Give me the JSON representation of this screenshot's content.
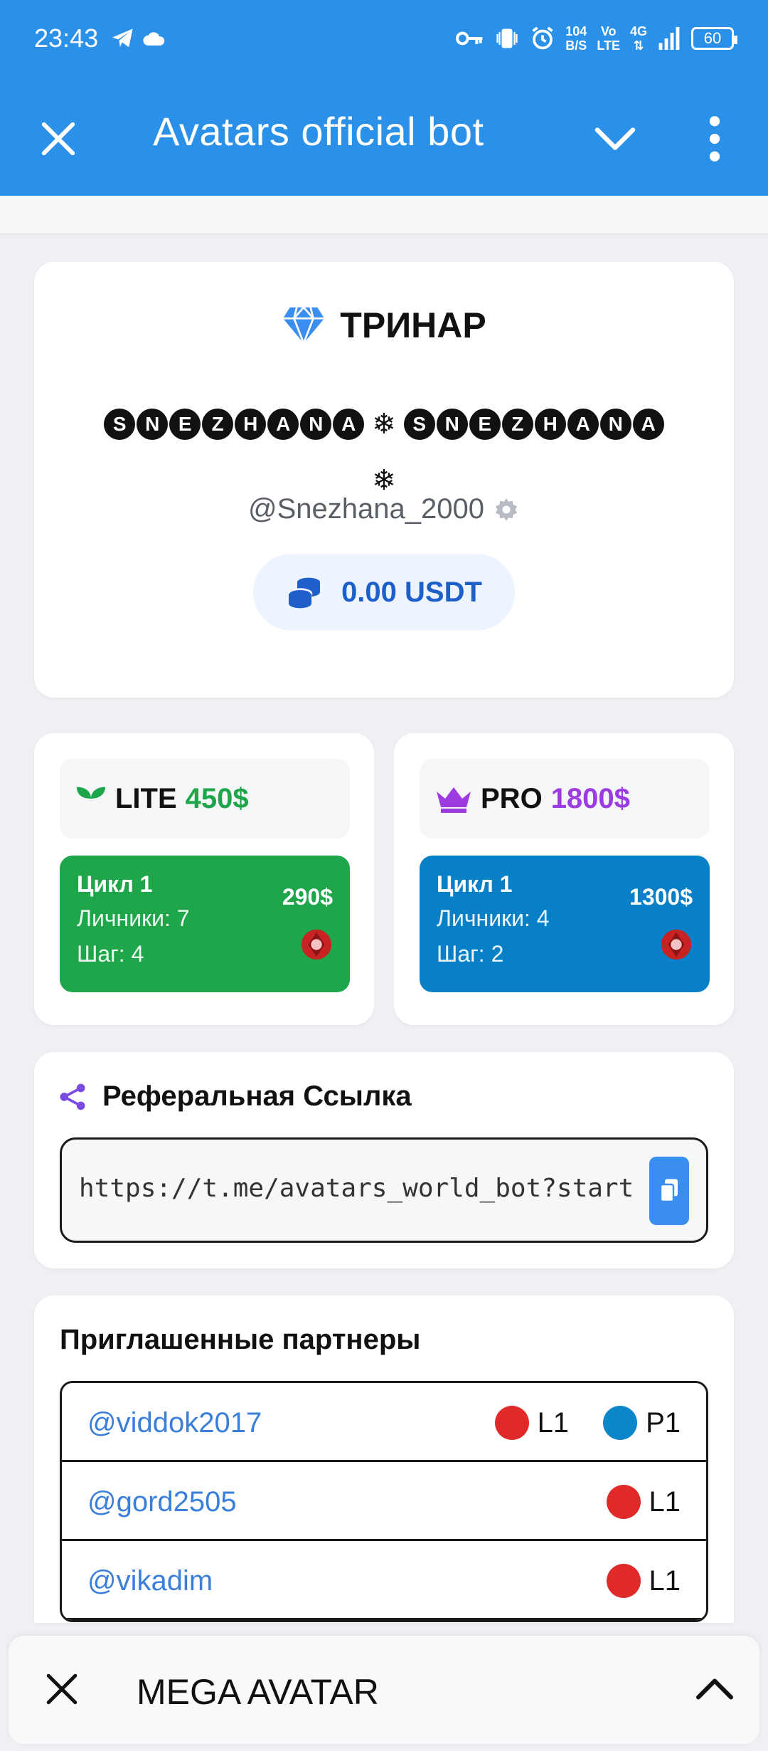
{
  "status_bar": {
    "time": "23:43",
    "net_speed_value": "104",
    "net_speed_unit": "B/S",
    "volte_top": "Vo",
    "volte_bottom": "LTE",
    "network": "4G",
    "battery": "60"
  },
  "app_bar": {
    "title": "Avatars official bot"
  },
  "profile": {
    "rank": "ТРИНАР",
    "display_name_part": "SNEZHANA",
    "username": "@Snezhana_2000",
    "balance": "0.00 USDT"
  },
  "tariffs": {
    "lite": {
      "name": "LITE",
      "price": "450$",
      "price_color": "#1fa64a",
      "cycle": "Цикл 1",
      "personal": "Личники: 7",
      "step": "Шаг: 4",
      "amount": "290$"
    },
    "pro": {
      "name": "PRO",
      "price": "1800$",
      "price_color": "#9b3be0",
      "cycle": "Цикл 1",
      "personal": "Личники: 4",
      "step": "Шаг: 2",
      "amount": "1300$"
    }
  },
  "referral": {
    "title": "Реферальная Ссылка",
    "url": "https://t.me/avatars_world_bot?start"
  },
  "partners": {
    "title": "Приглашенные партнеры",
    "rows": [
      {
        "username": "@viddok2017",
        "tags": [
          {
            "label": "L1",
            "color": "#e02a2a"
          },
          {
            "label": "P1",
            "color": "#0a86c9"
          }
        ]
      },
      {
        "username": "@gord2505",
        "tags": [
          {
            "label": "L1",
            "color": "#e02a2a"
          }
        ]
      },
      {
        "username": "@vikadim",
        "tags": [
          {
            "label": "L1",
            "color": "#e02a2a"
          }
        ]
      }
    ]
  },
  "mini_app_bar": {
    "title": "MEGA AVATAR"
  }
}
